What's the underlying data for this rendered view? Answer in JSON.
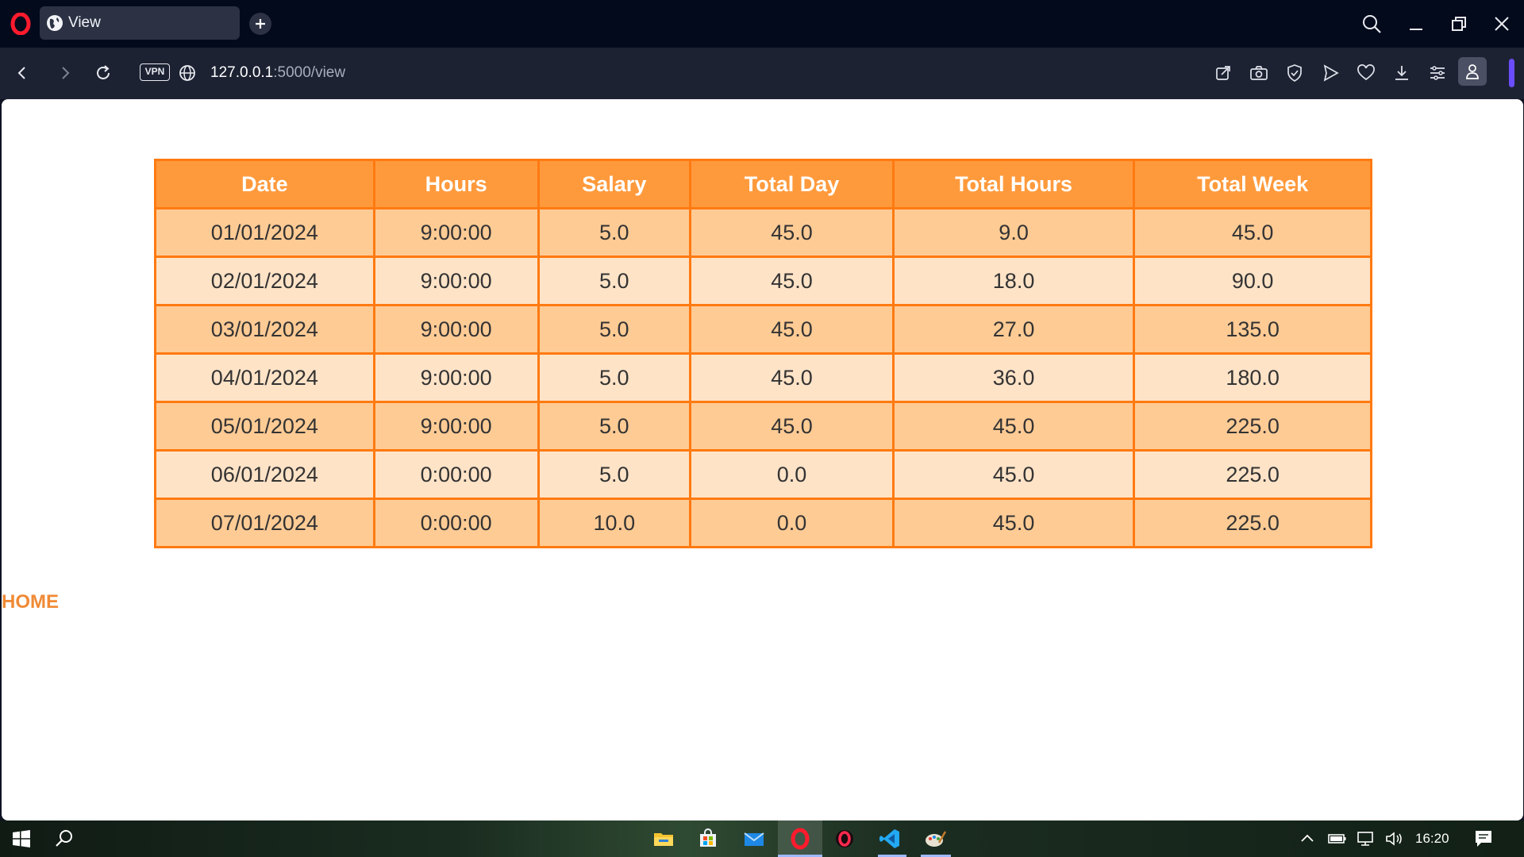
{
  "browser": {
    "tab": {
      "title": "View"
    },
    "address": {
      "host": "127.0.0.1",
      "path": ":5000/view"
    },
    "vpn_label": "VPN"
  },
  "page": {
    "table": {
      "headers": [
        "Date",
        "Hours",
        "Salary",
        "Total Day",
        "Total Hours",
        "Total Week"
      ],
      "rows": [
        [
          "01/01/2024",
          "9:00:00",
          "5.0",
          "45.0",
          "9.0",
          "45.0"
        ],
        [
          "02/01/2024",
          "9:00:00",
          "5.0",
          "45.0",
          "18.0",
          "90.0"
        ],
        [
          "03/01/2024",
          "9:00:00",
          "5.0",
          "45.0",
          "27.0",
          "135.0"
        ],
        [
          "04/01/2024",
          "9:00:00",
          "5.0",
          "45.0",
          "36.0",
          "180.0"
        ],
        [
          "05/01/2024",
          "9:00:00",
          "5.0",
          "45.0",
          "45.0",
          "225.0"
        ],
        [
          "06/01/2024",
          "0:00:00",
          "5.0",
          "0.0",
          "45.0",
          "225.0"
        ],
        [
          "07/01/2024",
          "0:00:00",
          "10.0",
          "0.0",
          "45.0",
          "225.0"
        ]
      ]
    },
    "home_link": "HOME"
  },
  "taskbar": {
    "clock": "16:20"
  },
  "colors": {
    "table_border": "#ff7a11",
    "header_bg": "#ff9a3c",
    "row_odd_bg": "#ffcb95",
    "row_even_bg": "#ffe3c7",
    "home_link": "#f08a35"
  },
  "icons": {
    "titlebar": [
      "opera-logo-icon",
      "globe-icon",
      "plus-icon",
      "search-icon",
      "minimize-icon",
      "restore-icon",
      "close-icon"
    ],
    "addressbar": [
      "back-icon",
      "forward-icon",
      "reload-icon",
      "globe-icon",
      "share-icon",
      "camera-icon",
      "shield-icon",
      "send-icon",
      "heart-icon",
      "download-icon",
      "easy-setup-icon",
      "profile-icon"
    ],
    "taskbar": [
      "windows-start-icon",
      "search-icon",
      "file-explorer-icon",
      "store-icon",
      "mail-icon",
      "opera-icon",
      "opera-gx-icon",
      "vscode-icon",
      "paint-icon",
      "chevron-up-icon",
      "battery-icon",
      "network-icon",
      "volume-icon",
      "notification-icon"
    ]
  }
}
